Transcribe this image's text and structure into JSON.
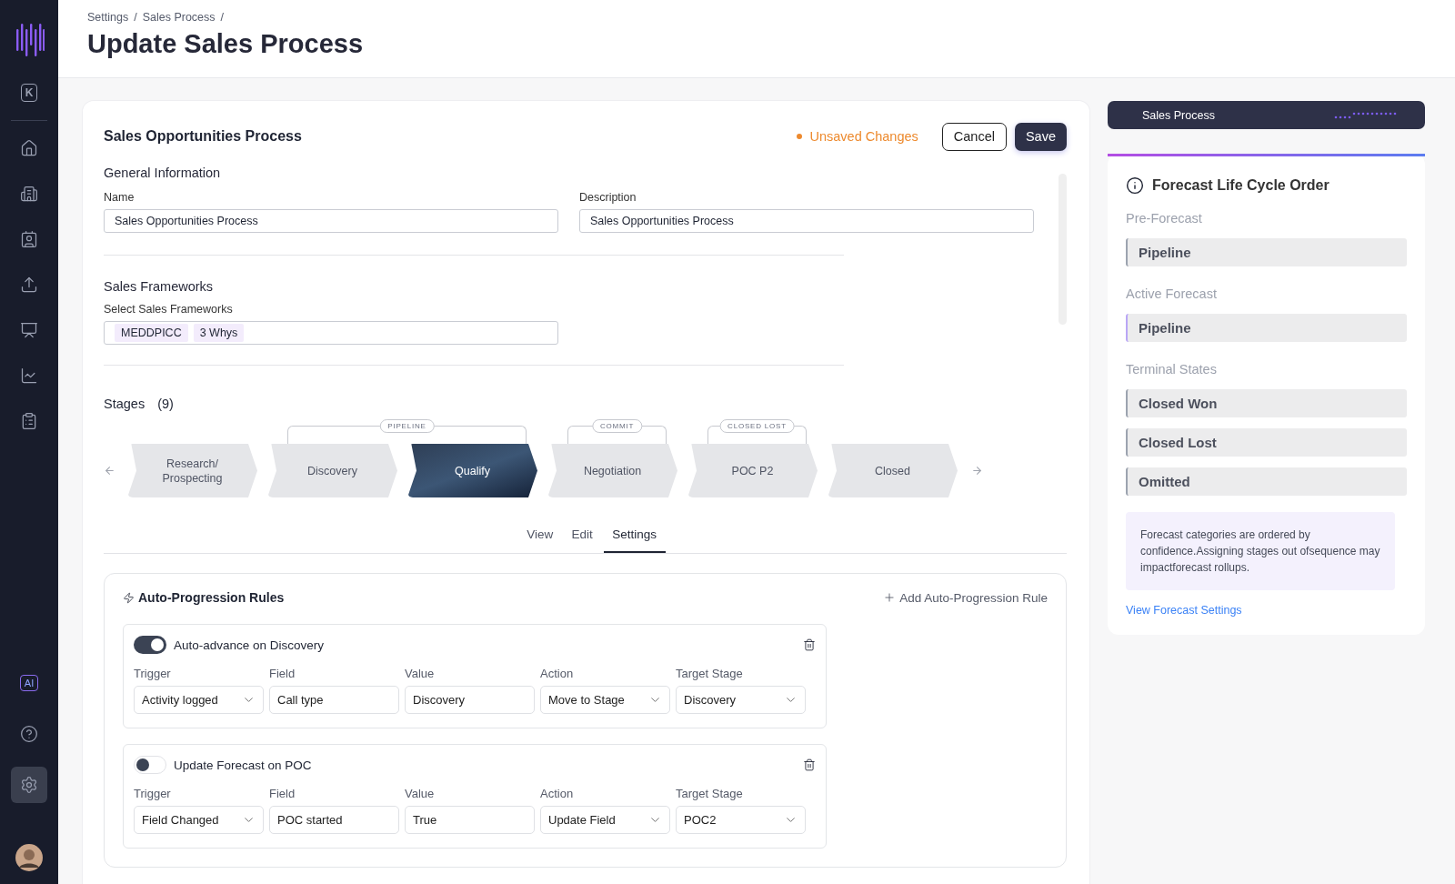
{
  "sidebar": {
    "top_items": [
      {
        "kind": "key",
        "label": "K",
        "selected": false
      }
    ],
    "nav_items": [
      {
        "kind": "home",
        "selected": false
      },
      {
        "kind": "building",
        "selected": false
      },
      {
        "kind": "badge",
        "selected": false
      },
      {
        "kind": "upload",
        "selected": false
      },
      {
        "kind": "presentation",
        "selected": false
      },
      {
        "kind": "chart",
        "selected": false
      },
      {
        "kind": "clipboard",
        "selected": false
      }
    ],
    "bottom_items": [
      {
        "kind": "ai",
        "label": "AI",
        "selected": false
      },
      {
        "kind": "help",
        "selected": false
      },
      {
        "kind": "settings",
        "selected": true
      }
    ]
  },
  "header": {
    "breadcrumb": [
      "Settings",
      "Sales Process"
    ],
    "separator": "/",
    "title": "Update Sales Process"
  },
  "editor": {
    "title": "Sales Opportunities Process",
    "status": "Unsaved Changes",
    "buttons": [
      {
        "kind": "secondary",
        "label": "Cancel"
      },
      {
        "kind": "primary",
        "label": "Save"
      }
    ],
    "general": {
      "heading": "General Information",
      "fields": [
        {
          "label": "Name",
          "value": "Sales Opportunities Process"
        },
        {
          "label": "Description",
          "value": "Sales Opportunities Process"
        }
      ]
    },
    "frameworks": {
      "heading": "Sales Frameworks",
      "label": "Select Sales Frameworks",
      "tags": [
        "MEDDPICC",
        "3 Whys"
      ]
    },
    "stages": {
      "heading": "Stages",
      "count": "(9)",
      "lanes": [
        {
          "kind": "plain",
          "stages": [
            {
              "label": "Research/ Prospecting",
              "selected": false
            }
          ]
        },
        {
          "kind": "bracket",
          "label": "PIPELINE",
          "stages": [
            {
              "label": "Discovery",
              "selected": false
            },
            {
              "label": "Qualify",
              "selected": true
            }
          ]
        },
        {
          "kind": "bracket",
          "label": "COMMIT",
          "stages": [
            {
              "label": "Negotiation",
              "selected": false
            }
          ]
        },
        {
          "kind": "bracket",
          "label": "CLOSED LOST",
          "stages": [
            {
              "label": "POC P2",
              "selected": false
            }
          ]
        },
        {
          "kind": "plain",
          "stages": [
            {
              "label": "Closed",
              "selected": false
            }
          ]
        }
      ]
    },
    "tabs": [
      {
        "label": "View",
        "selected": false
      },
      {
        "label": "Edit",
        "selected": false
      },
      {
        "label": "Settings",
        "selected": true
      }
    ],
    "rules_panel": {
      "title": "Auto-Progression Rules",
      "add_label": "Add Auto-Progression Rule",
      "rules": [
        {
          "name": "Auto-advance on Discovery",
          "on": true,
          "fields": [
            {
              "label": "Trigger",
              "value": "Activity logged",
              "kind": "select"
            },
            {
              "label": "Field",
              "value": "Call type",
              "kind": "text"
            },
            {
              "label": "Value",
              "value": "Discovery",
              "kind": "text"
            },
            {
              "label": "Action",
              "value": "Move to Stage",
              "kind": "select"
            },
            {
              "label": "Target Stage",
              "value": "Discovery",
              "kind": "select"
            }
          ]
        },
        {
          "name": "Update Forecast on POC",
          "on": false,
          "fields": [
            {
              "label": "Trigger",
              "value": "Field Changed",
              "kind": "select"
            },
            {
              "label": "Field",
              "value": "POC started",
              "kind": "text"
            },
            {
              "label": "Value",
              "value": "True",
              "kind": "text"
            },
            {
              "label": "Action",
              "value": "Update Field",
              "kind": "select"
            },
            {
              "label": "Target Stage",
              "value": "POC2",
              "kind": "select"
            }
          ]
        }
      ]
    }
  },
  "side_panel": {
    "banner": "Sales Process",
    "title": "Forecast Life Cycle Order",
    "sections": [
      {
        "heading": "Pre-Forecast",
        "items": [
          {
            "label": "Pipeline",
            "color": "#9ca3af"
          }
        ]
      },
      {
        "heading": "Active Forecast",
        "items": [
          {
            "label": "Pipeline",
            "color": "#b9a6f5"
          }
        ]
      },
      {
        "heading": "Terminal States",
        "items": [
          {
            "label": "Closed Won",
            "color": "#9ca3af"
          },
          {
            "label": "Closed Lost",
            "color": "#9ca3af"
          },
          {
            "label": "Omitted",
            "color": "#9ca3af"
          }
        ]
      }
    ],
    "note": "Forecast categories are ordered by confidence.Assigning stages out ofsequence may impactforecast rollups.",
    "link": "View Forecast Settings"
  }
}
